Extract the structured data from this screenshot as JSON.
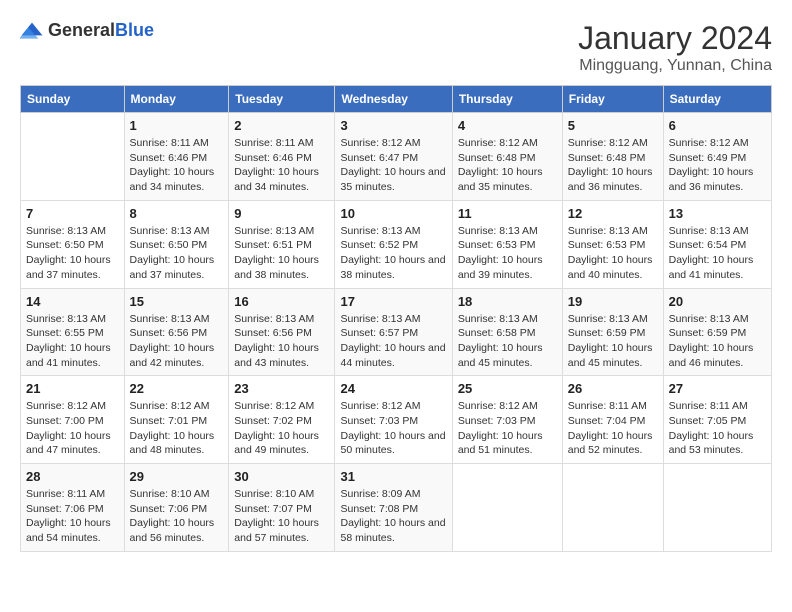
{
  "logo": {
    "general": "General",
    "blue": "Blue"
  },
  "header": {
    "title": "January 2024",
    "subtitle": "Mingguang, Yunnan, China"
  },
  "days_of_week": [
    "Sunday",
    "Monday",
    "Tuesday",
    "Wednesday",
    "Thursday",
    "Friday",
    "Saturday"
  ],
  "weeks": [
    [
      {
        "num": "",
        "sunrise": "",
        "sunset": "",
        "daylight": ""
      },
      {
        "num": "1",
        "sunrise": "Sunrise: 8:11 AM",
        "sunset": "Sunset: 6:46 PM",
        "daylight": "Daylight: 10 hours and 34 minutes."
      },
      {
        "num": "2",
        "sunrise": "Sunrise: 8:11 AM",
        "sunset": "Sunset: 6:46 PM",
        "daylight": "Daylight: 10 hours and 34 minutes."
      },
      {
        "num": "3",
        "sunrise": "Sunrise: 8:12 AM",
        "sunset": "Sunset: 6:47 PM",
        "daylight": "Daylight: 10 hours and 35 minutes."
      },
      {
        "num": "4",
        "sunrise": "Sunrise: 8:12 AM",
        "sunset": "Sunset: 6:48 PM",
        "daylight": "Daylight: 10 hours and 35 minutes."
      },
      {
        "num": "5",
        "sunrise": "Sunrise: 8:12 AM",
        "sunset": "Sunset: 6:48 PM",
        "daylight": "Daylight: 10 hours and 36 minutes."
      },
      {
        "num": "6",
        "sunrise": "Sunrise: 8:12 AM",
        "sunset": "Sunset: 6:49 PM",
        "daylight": "Daylight: 10 hours and 36 minutes."
      }
    ],
    [
      {
        "num": "7",
        "sunrise": "Sunrise: 8:13 AM",
        "sunset": "Sunset: 6:50 PM",
        "daylight": "Daylight: 10 hours and 37 minutes."
      },
      {
        "num": "8",
        "sunrise": "Sunrise: 8:13 AM",
        "sunset": "Sunset: 6:50 PM",
        "daylight": "Daylight: 10 hours and 37 minutes."
      },
      {
        "num": "9",
        "sunrise": "Sunrise: 8:13 AM",
        "sunset": "Sunset: 6:51 PM",
        "daylight": "Daylight: 10 hours and 38 minutes."
      },
      {
        "num": "10",
        "sunrise": "Sunrise: 8:13 AM",
        "sunset": "Sunset: 6:52 PM",
        "daylight": "Daylight: 10 hours and 38 minutes."
      },
      {
        "num": "11",
        "sunrise": "Sunrise: 8:13 AM",
        "sunset": "Sunset: 6:53 PM",
        "daylight": "Daylight: 10 hours and 39 minutes."
      },
      {
        "num": "12",
        "sunrise": "Sunrise: 8:13 AM",
        "sunset": "Sunset: 6:53 PM",
        "daylight": "Daylight: 10 hours and 40 minutes."
      },
      {
        "num": "13",
        "sunrise": "Sunrise: 8:13 AM",
        "sunset": "Sunset: 6:54 PM",
        "daylight": "Daylight: 10 hours and 41 minutes."
      }
    ],
    [
      {
        "num": "14",
        "sunrise": "Sunrise: 8:13 AM",
        "sunset": "Sunset: 6:55 PM",
        "daylight": "Daylight: 10 hours and 41 minutes."
      },
      {
        "num": "15",
        "sunrise": "Sunrise: 8:13 AM",
        "sunset": "Sunset: 6:56 PM",
        "daylight": "Daylight: 10 hours and 42 minutes."
      },
      {
        "num": "16",
        "sunrise": "Sunrise: 8:13 AM",
        "sunset": "Sunset: 6:56 PM",
        "daylight": "Daylight: 10 hours and 43 minutes."
      },
      {
        "num": "17",
        "sunrise": "Sunrise: 8:13 AM",
        "sunset": "Sunset: 6:57 PM",
        "daylight": "Daylight: 10 hours and 44 minutes."
      },
      {
        "num": "18",
        "sunrise": "Sunrise: 8:13 AM",
        "sunset": "Sunset: 6:58 PM",
        "daylight": "Daylight: 10 hours and 45 minutes."
      },
      {
        "num": "19",
        "sunrise": "Sunrise: 8:13 AM",
        "sunset": "Sunset: 6:59 PM",
        "daylight": "Daylight: 10 hours and 45 minutes."
      },
      {
        "num": "20",
        "sunrise": "Sunrise: 8:13 AM",
        "sunset": "Sunset: 6:59 PM",
        "daylight": "Daylight: 10 hours and 46 minutes."
      }
    ],
    [
      {
        "num": "21",
        "sunrise": "Sunrise: 8:12 AM",
        "sunset": "Sunset: 7:00 PM",
        "daylight": "Daylight: 10 hours and 47 minutes."
      },
      {
        "num": "22",
        "sunrise": "Sunrise: 8:12 AM",
        "sunset": "Sunset: 7:01 PM",
        "daylight": "Daylight: 10 hours and 48 minutes."
      },
      {
        "num": "23",
        "sunrise": "Sunrise: 8:12 AM",
        "sunset": "Sunset: 7:02 PM",
        "daylight": "Daylight: 10 hours and 49 minutes."
      },
      {
        "num": "24",
        "sunrise": "Sunrise: 8:12 AM",
        "sunset": "Sunset: 7:03 PM",
        "daylight": "Daylight: 10 hours and 50 minutes."
      },
      {
        "num": "25",
        "sunrise": "Sunrise: 8:12 AM",
        "sunset": "Sunset: 7:03 PM",
        "daylight": "Daylight: 10 hours and 51 minutes."
      },
      {
        "num": "26",
        "sunrise": "Sunrise: 8:11 AM",
        "sunset": "Sunset: 7:04 PM",
        "daylight": "Daylight: 10 hours and 52 minutes."
      },
      {
        "num": "27",
        "sunrise": "Sunrise: 8:11 AM",
        "sunset": "Sunset: 7:05 PM",
        "daylight": "Daylight: 10 hours and 53 minutes."
      }
    ],
    [
      {
        "num": "28",
        "sunrise": "Sunrise: 8:11 AM",
        "sunset": "Sunset: 7:06 PM",
        "daylight": "Daylight: 10 hours and 54 minutes."
      },
      {
        "num": "29",
        "sunrise": "Sunrise: 8:10 AM",
        "sunset": "Sunset: 7:06 PM",
        "daylight": "Daylight: 10 hours and 56 minutes."
      },
      {
        "num": "30",
        "sunrise": "Sunrise: 8:10 AM",
        "sunset": "Sunset: 7:07 PM",
        "daylight": "Daylight: 10 hours and 57 minutes."
      },
      {
        "num": "31",
        "sunrise": "Sunrise: 8:09 AM",
        "sunset": "Sunset: 7:08 PM",
        "daylight": "Daylight: 10 hours and 58 minutes."
      },
      {
        "num": "",
        "sunrise": "",
        "sunset": "",
        "daylight": ""
      },
      {
        "num": "",
        "sunrise": "",
        "sunset": "",
        "daylight": ""
      },
      {
        "num": "",
        "sunrise": "",
        "sunset": "",
        "daylight": ""
      }
    ]
  ]
}
